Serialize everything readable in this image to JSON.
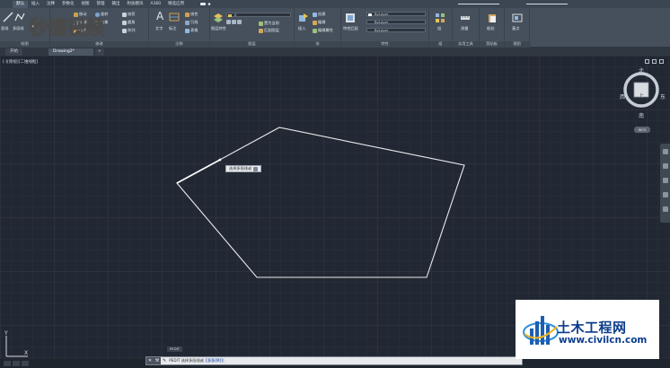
{
  "ribbon_tabs": [
    "默认",
    "插入",
    "注释",
    "参数化",
    "视图",
    "管理",
    "输出",
    "附加模块",
    "A360",
    "精选应用"
  ],
  "ribbon": {
    "draw": {
      "title": "绘图",
      "line": "直线",
      "polyline": "多段线",
      "move": "移动",
      "rotate": "旋转",
      "copy": "复制",
      "mirror": "镜像",
      "stretch": "拉伸"
    },
    "modify": {
      "title": "修改",
      "trim": "修剪",
      "fillet": "圆角",
      "array": "阵列"
    },
    "annotation": {
      "title": "注释",
      "text": "文字",
      "dim": "标注",
      "linear": "线性",
      "leader": "引线",
      "table": "表格"
    },
    "layers": {
      "title": "图层",
      "layer_props": "图层特性",
      "layer_value": "0",
      "make_current": "置为当前",
      "match_layer": "匹配图层"
    },
    "block": {
      "title": "块",
      "insert": "插入",
      "create": "创建",
      "edit": "编辑",
      "edit_attr": "编辑属性"
    },
    "properties": {
      "title": "特性",
      "match": "特性匹配",
      "bylayer1": "ByLayer",
      "bylayer2": "ByLayer",
      "bylayer3": "ByLayer"
    },
    "groups": {
      "title": "组",
      "group": "组"
    },
    "utilities": {
      "title": "实用工具",
      "measure": "测量"
    },
    "clipboard": {
      "title": "剪贴板",
      "paste": "粘贴"
    },
    "view": {
      "title": "视图",
      "base": "基点"
    }
  },
  "file_tabs": {
    "start": "开始",
    "drawing": "Drawing2*",
    "add": "+"
  },
  "viewport_label": "[-][俯视][二维线框]",
  "tooltip": {
    "label": "选择多段线或"
  },
  "viewcube": {
    "north": "北",
    "south": "南",
    "east": "东",
    "west": "西",
    "top": "上",
    "wcs": "WCS"
  },
  "ucs": {
    "y": "Y",
    "x": "X"
  },
  "command": {
    "history": "PEDIT",
    "prompt": "PEDIT 选择多段线或",
    "option": "[多条(M)]:"
  },
  "watermarks": {
    "logo": "秒懂视频",
    "site_cn": "土木工程网",
    "site_url": "www.civilcn.com"
  },
  "colors": {
    "canvas": "#222833",
    "polyline": "#e8ebee",
    "ribbon": "#46505c",
    "accent": "#0b3c8c"
  }
}
